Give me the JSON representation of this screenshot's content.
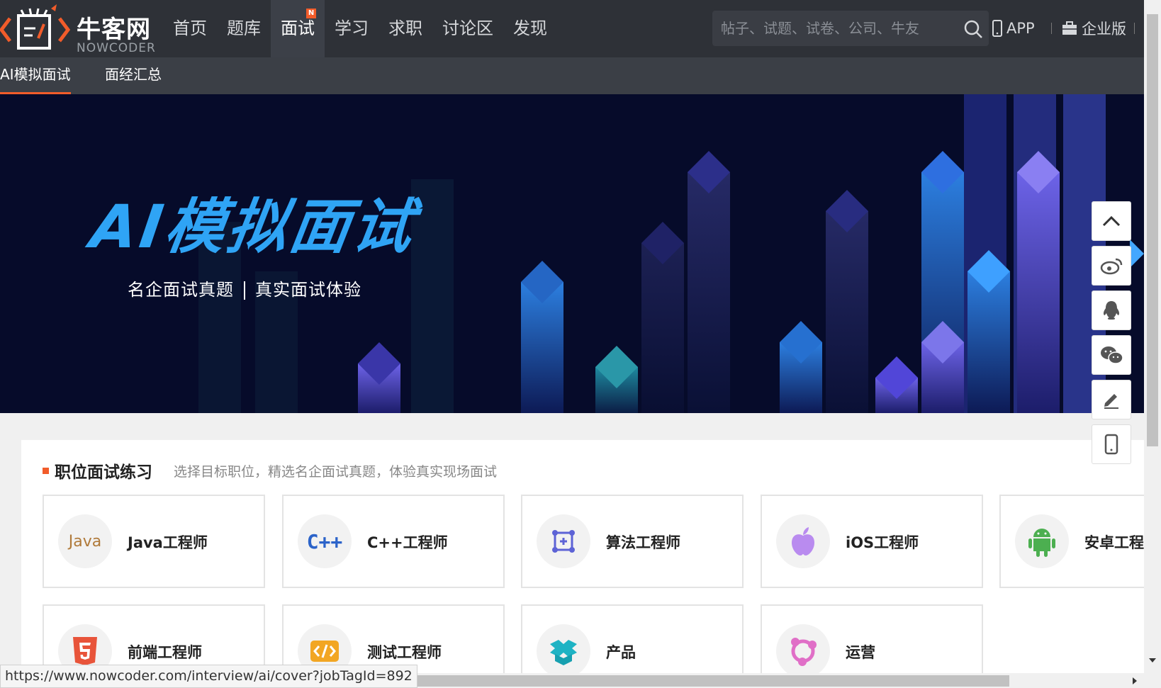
{
  "header": {
    "logo_text": "牛客网",
    "logo_sub": "NOWCODER",
    "nav": [
      {
        "label": "首页"
      },
      {
        "label": "题库"
      },
      {
        "label": "面试",
        "badge": "N"
      },
      {
        "label": "学习"
      },
      {
        "label": "求职"
      },
      {
        "label": "讨论区"
      },
      {
        "label": "发现"
      }
    ],
    "search_placeholder": "帖子、试题、试卷、公司、牛友",
    "app_label": "APP",
    "enterprise_label": "企业版"
  },
  "subnav": {
    "items": [
      {
        "label": "AI模拟面试",
        "active": true
      },
      {
        "label": "面经汇总",
        "active": false
      }
    ]
  },
  "banner": {
    "title": "AI模拟面试",
    "sub_left": "名企面试真题",
    "sub_right": "真实面试体验"
  },
  "section": {
    "title": "职位面试练习",
    "desc": "选择目标职位，精选名企面试真题，体验真实现场面试"
  },
  "jobs": [
    {
      "label": "Java工程师",
      "icon": "java-icon"
    },
    {
      "label": "C++工程师",
      "icon": "cpp-icon"
    },
    {
      "label": "算法工程师",
      "icon": "algorithm-icon"
    },
    {
      "label": "iOS工程师",
      "icon": "apple-icon"
    },
    {
      "label": "安卓工程",
      "icon": "android-icon"
    },
    {
      "label": "前端工程师",
      "icon": "html5-icon"
    },
    {
      "label": "测试工程师",
      "icon": "code-icon"
    },
    {
      "label": "产品",
      "icon": "box-icon"
    },
    {
      "label": "运营",
      "icon": "cycle-icon"
    }
  ],
  "icon_text": {
    "java": "Java",
    "cpp": "C++"
  },
  "status_url": "https://www.nowcoder.com/interview/ai/cover?jobTagId=892",
  "colors": {
    "accent": "#f25c2a",
    "nav_bg": "#2e3137",
    "banner_bg": "#060b2a",
    "banner_title": "#2fa4f5"
  }
}
